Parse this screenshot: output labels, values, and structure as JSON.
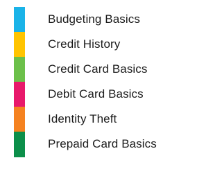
{
  "topics": [
    {
      "label": "Budgeting Basics",
      "color": "#1ab3e8"
    },
    {
      "label": "Credit History",
      "color": "#ffc400"
    },
    {
      "label": "Credit Card Basics",
      "color": "#6cc04a"
    },
    {
      "label": "Debit Card Basics",
      "color": "#e8196b"
    },
    {
      "label": "Identity Theft",
      "color": "#f58220"
    },
    {
      "label": "Prepaid Card Basics",
      "color": "#0c8f4a"
    }
  ]
}
